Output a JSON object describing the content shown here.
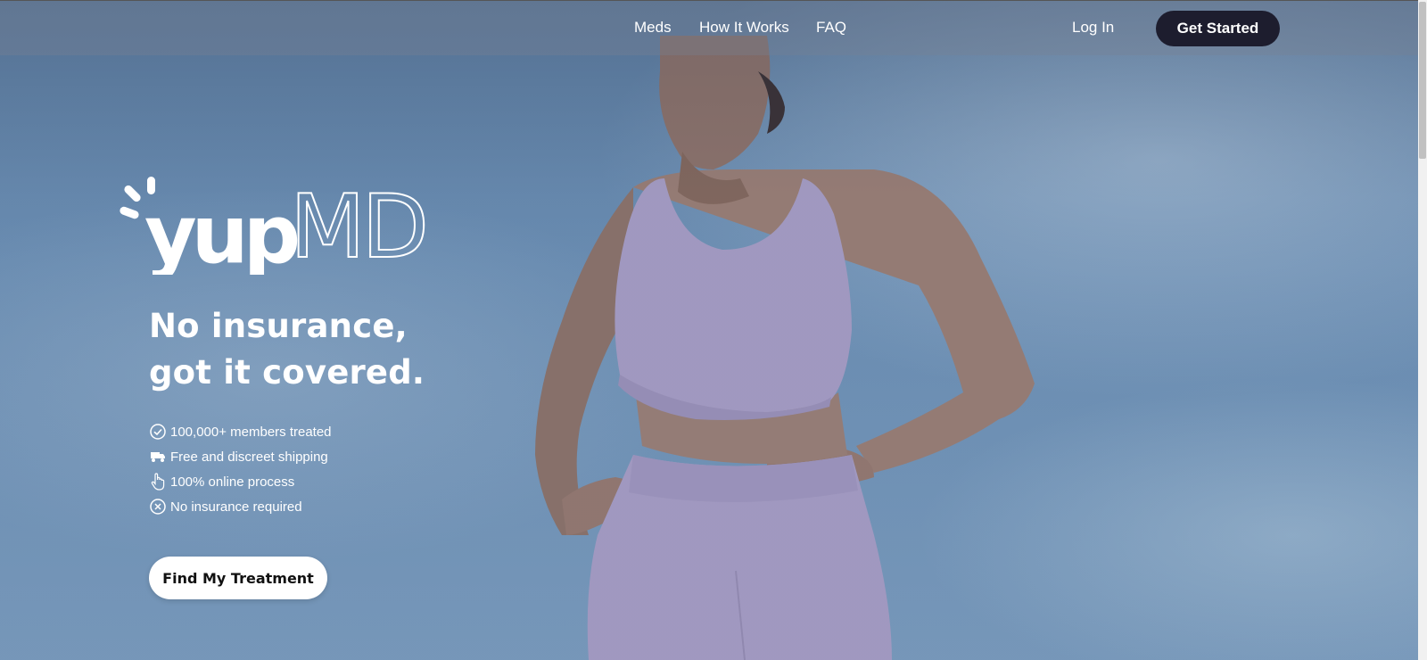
{
  "nav": {
    "links": [
      "Meds",
      "How It Works",
      "FAQ"
    ],
    "login": "Log In",
    "get_started": "Get Started"
  },
  "brand": {
    "name_part1": "yup",
    "name_part2": "MD",
    "logo_icon": "sparkle-burst-icon"
  },
  "hero": {
    "headline_line1": "No insurance,",
    "headline_line2": "got it covered.",
    "features": [
      {
        "icon": "check-circle-icon",
        "text": "100,000+ members treated"
      },
      {
        "icon": "truck-icon",
        "text": "Free and discreet shipping"
      },
      {
        "icon": "hand-pointer-icon",
        "text": "100% online process"
      },
      {
        "icon": "x-circle-icon",
        "text": "No insurance required"
      }
    ],
    "cta": "Find My Treatment"
  },
  "colors": {
    "accent_dark": "#1d1d2e",
    "hero_blue": "#6c90b6",
    "outfit_lavender": "#a79ec6",
    "white": "#ffffff"
  }
}
